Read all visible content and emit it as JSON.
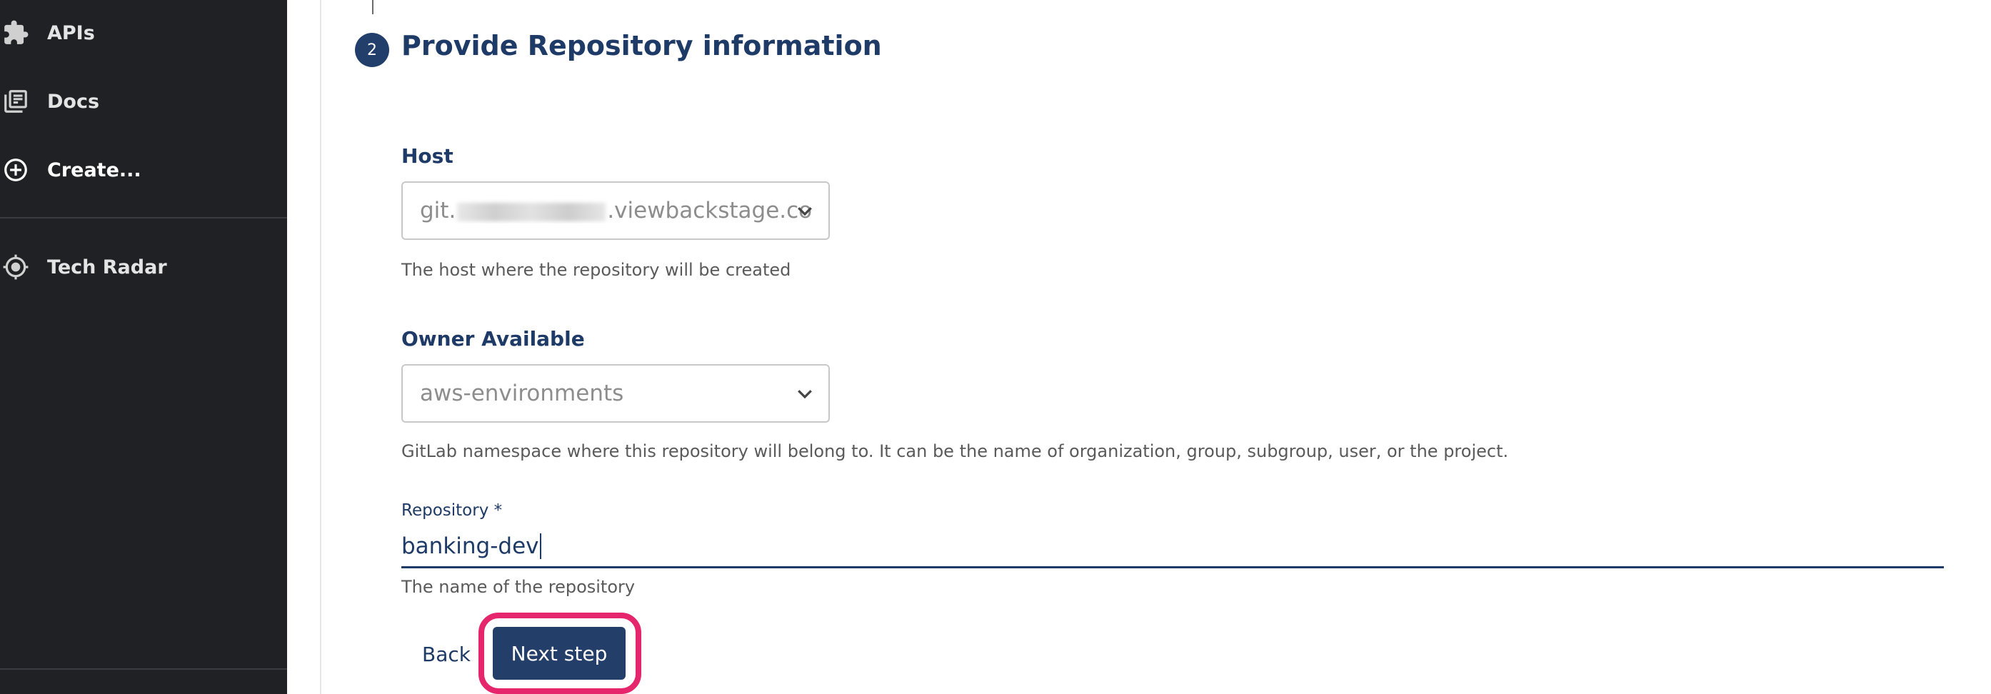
{
  "sidebar": {
    "items": [
      {
        "label": "APIs",
        "icon": "puzzle-icon"
      },
      {
        "label": "Docs",
        "icon": "library-icon"
      },
      {
        "label": "Create...",
        "icon": "add-circle-icon"
      },
      {
        "label": "Tech Radar",
        "icon": "radar-icon"
      }
    ]
  },
  "step": {
    "number": "2",
    "title": "Provide Repository information"
  },
  "host": {
    "label": "Host",
    "value_prefix": "git.",
    "value_suffix": ".viewbackstage.co",
    "help": "The host where the repository will be created"
  },
  "owner": {
    "label": "Owner Available",
    "value": "aws-environments",
    "help": "GitLab namespace where this repository will belong to. It can be the name of organization, group, subgroup, user, or the project."
  },
  "repository": {
    "label": "Repository *",
    "value": "banking-dev",
    "help": "The name of the repository"
  },
  "actions": {
    "back_label": "Back",
    "next_label": "Next step"
  },
  "colors": {
    "sidebar_bg": "#1f2125",
    "primary": "#223e6b",
    "highlight": "#e6266c"
  }
}
